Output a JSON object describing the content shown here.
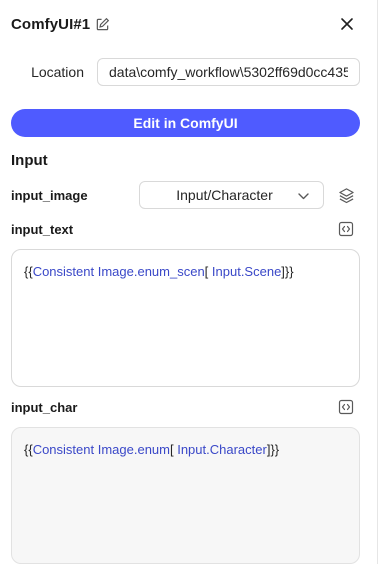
{
  "header": {
    "title": "ComfyUI#1",
    "edit_icon": "pencil-square-icon",
    "close_icon": "close-icon"
  },
  "location": {
    "label": "Location",
    "value": "data\\comfy_workflow\\5302ff69d0cc435"
  },
  "edit_button": {
    "label": "Edit in ComfyUI",
    "color": "#4f5bff"
  },
  "input_section": {
    "title": "Input",
    "fields": [
      {
        "label": "input_image",
        "select_value": "Input/Character",
        "side_icon": "layers-icon"
      },
      {
        "label": "input_text",
        "side_icon": "code-brackets-icon",
        "expr": {
          "open": "{{",
          "ref1": "Consistent Image.enum_scen",
          "mid": "[ ",
          "ref2": "Input.Scene",
          "close": "]}}"
        }
      },
      {
        "label": "input_char",
        "side_icon": "code-brackets-icon",
        "expr": {
          "open": "{{",
          "ref1": "Consistent Image.enum",
          "mid": "[ ",
          "ref2": "Input.Character",
          "close": "]}}"
        }
      }
    ]
  },
  "colors": {
    "accent": "#4f5bff",
    "reference_text": "#3a48c8"
  }
}
